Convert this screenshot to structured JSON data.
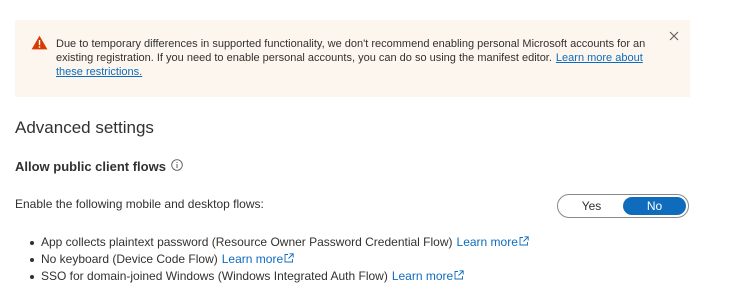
{
  "colors": {
    "banner_background": "#fdf6ef",
    "warning_icon": "#d83b01",
    "link": "#0f6cbd",
    "toggle_selected": "#0f6cbd"
  },
  "banner": {
    "icon": "warning-icon",
    "message": "Due to temporary differences in supported functionality, we don't recommend enabling personal Microsoft accounts for an existing registration. If you need to enable personal accounts, you can do so using the manifest editor.",
    "link_text": "Learn more about these restrictions.",
    "close_icon": "close-icon"
  },
  "section": {
    "title": "Advanced settings"
  },
  "public_client_flows": {
    "title": "Allow public client flows",
    "info_icon": "info-icon",
    "label": "Enable the following mobile and desktop flows:",
    "toggle": {
      "options": [
        "Yes",
        "No"
      ],
      "selected": "No"
    },
    "flows": [
      {
        "text": "App collects plaintext password (Resource Owner Password Credential Flow)",
        "link_text": "Learn more"
      },
      {
        "text": "No keyboard (Device Code Flow)",
        "link_text": "Learn more"
      },
      {
        "text": "SSO for domain-joined Windows (Windows Integrated Auth Flow)",
        "link_text": "Learn more"
      }
    ]
  }
}
